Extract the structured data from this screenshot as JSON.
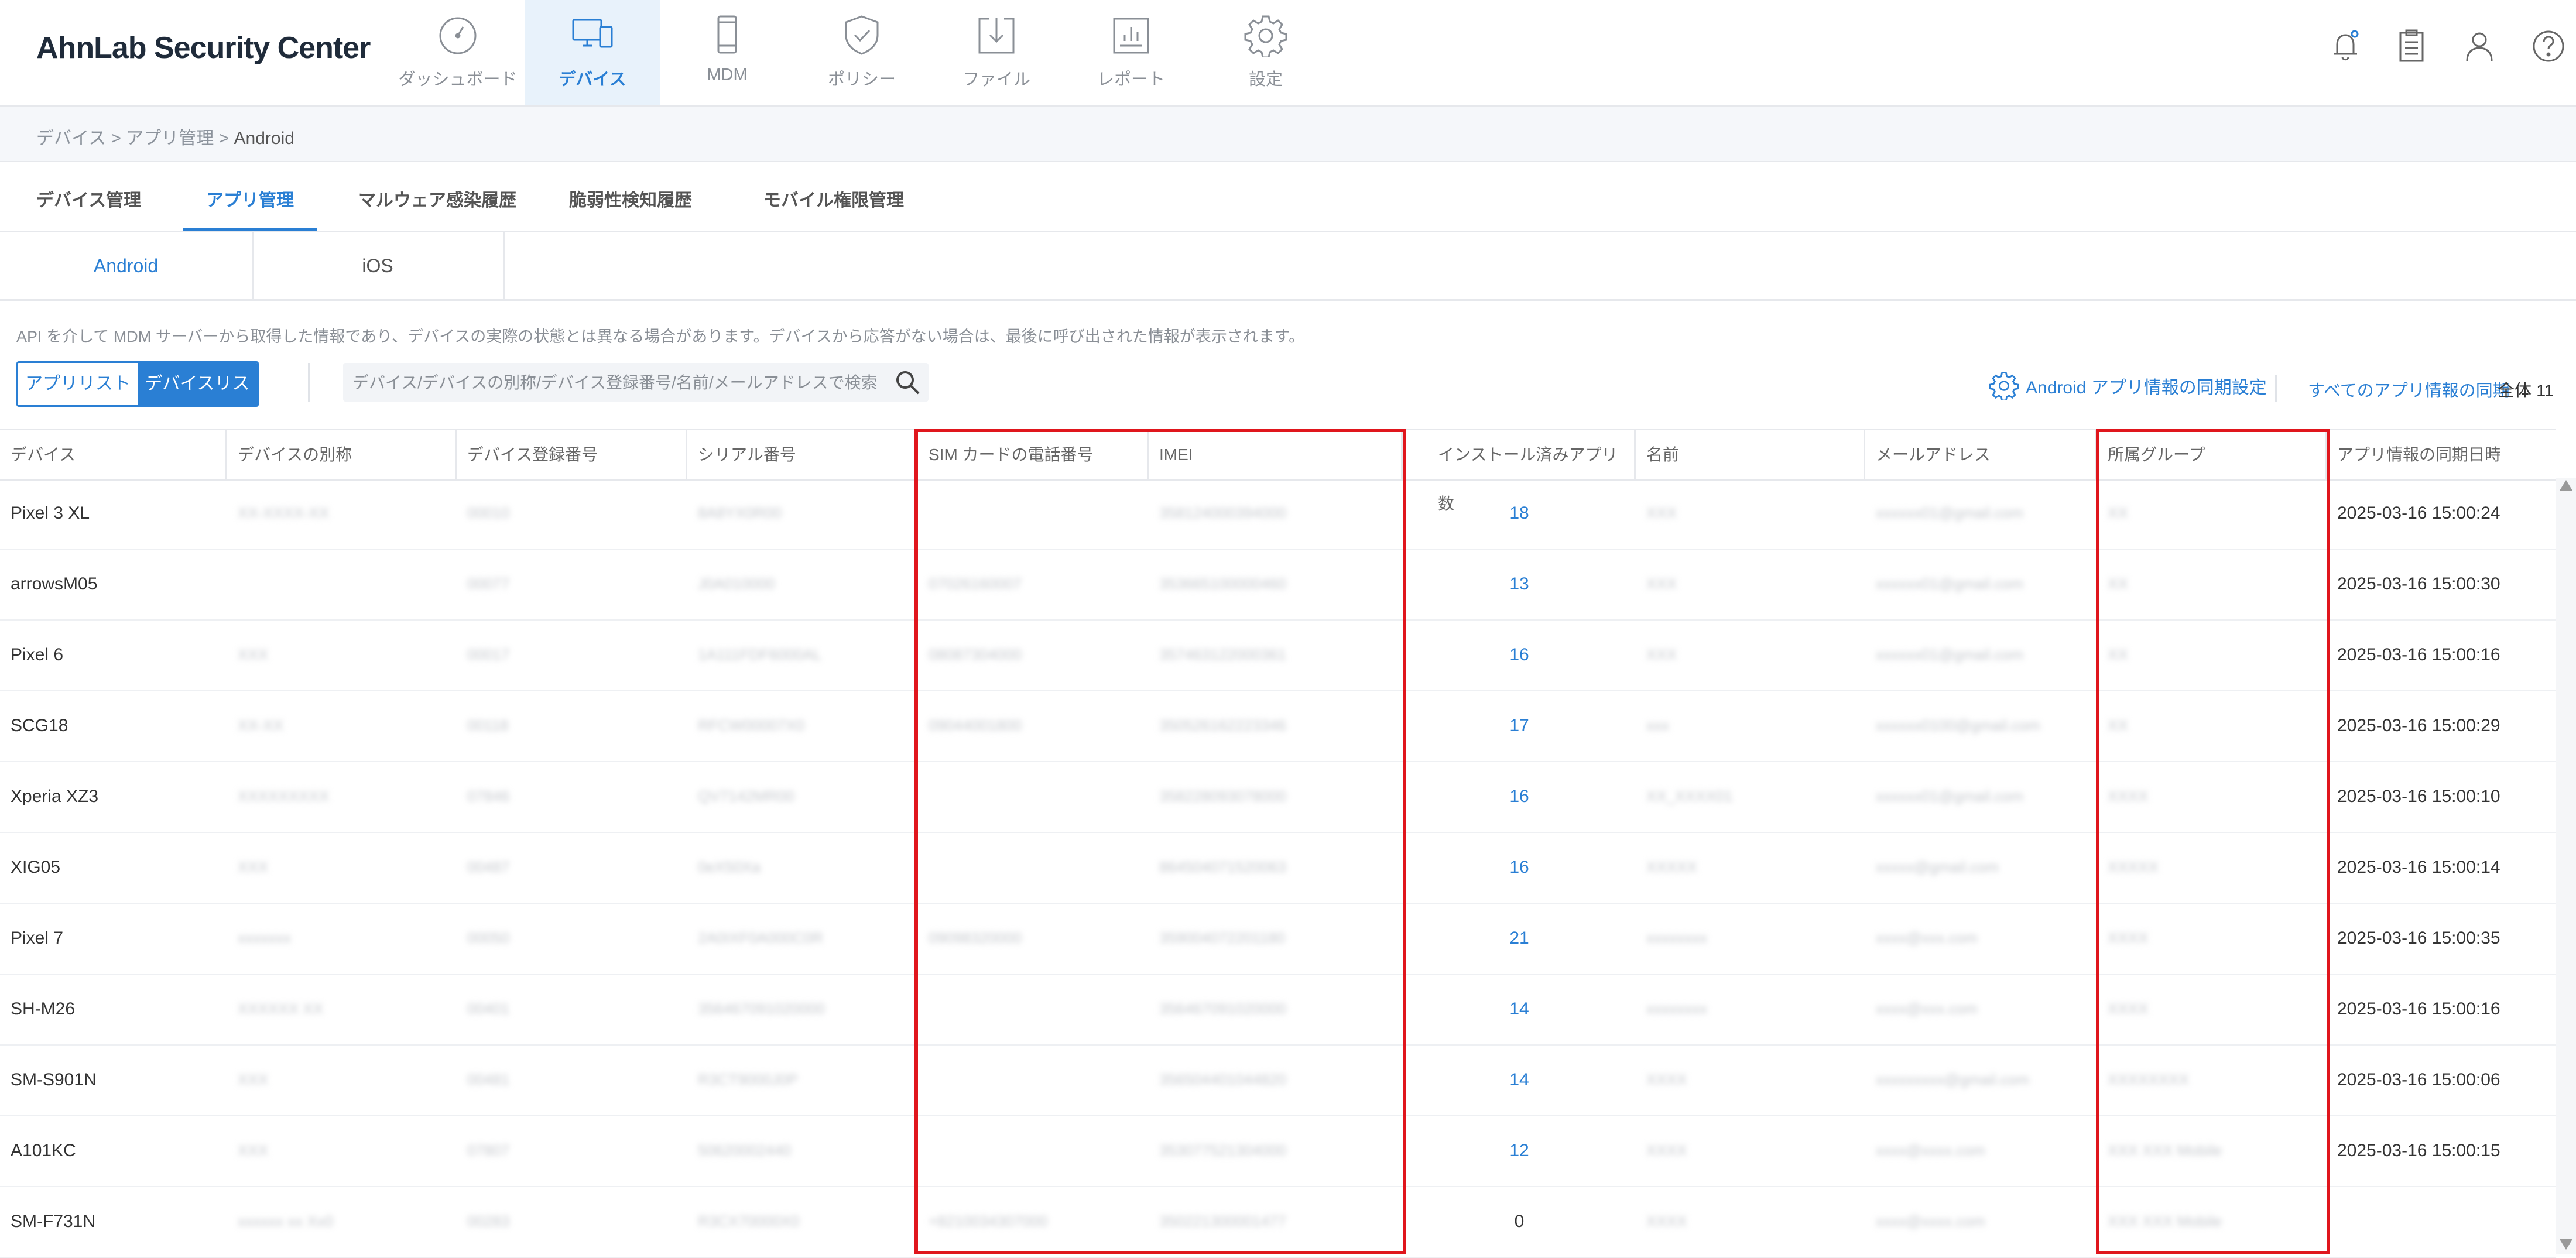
{
  "app": {
    "title": "AhnLab Security Center"
  },
  "nav": [
    {
      "label": "ダッシュボード",
      "icon": "dashboard-icon"
    },
    {
      "label": "デバイス",
      "icon": "device-icon",
      "active": true
    },
    {
      "label": "MDM",
      "icon": "mobile-icon"
    },
    {
      "label": "ポリシー",
      "icon": "shield-icon"
    },
    {
      "label": "ファイル",
      "icon": "file-download-icon"
    },
    {
      "label": "レポート",
      "icon": "report-icon"
    },
    {
      "label": "設定",
      "icon": "gear-icon"
    }
  ],
  "header_icons": [
    "bell-icon",
    "clipboard-icon",
    "user-icon",
    "help-icon"
  ],
  "breadcrumb": {
    "part1": "デバイス",
    "sep": " > ",
    "part2": "アプリ管理",
    "current": "Android"
  },
  "subtabs": [
    "デバイス管理",
    "アプリ管理",
    "マルウェア感染履歴",
    "脆弱性検知履歴",
    "モバイル権限管理"
  ],
  "ostabs": [
    "Android",
    "iOS"
  ],
  "notice": "API を介して MDM サーバーから取得した情報であり、デバイスの実際の状態とは異なる場合があります。デバイスから応答がない場合は、最後に呼び出された情報が表示されます。",
  "toolbar": {
    "app_list": "アプリリスト",
    "device_list": "デバイスリスト",
    "search_placeholder": "デバイス/デバイスの別称/デバイス登録番号/名前/メールアドレスで検索",
    "sync_settings": "Android アプリ情報の同期設定",
    "sync_all": "すべてのアプリ情報の同期",
    "total_label": "全体",
    "total_count": "11"
  },
  "table": {
    "columns": [
      "デバイス",
      "デバイスの別称",
      "デバイス登録番号",
      "シリアル番号",
      "SIM カードの電話番号",
      "IMEI",
      "インストール済みアプリ数",
      "名前",
      "メールアドレス",
      "所属グループ",
      "アプリ情報の同期日時"
    ],
    "rows": [
      {
        "device": "Pixel 3 XL",
        "alias": "XX-XXXX-XX",
        "regno": "00010",
        "serial": "8A8YX0R00",
        "sim": "",
        "imei": "358124000394000",
        "apps": "18",
        "name": "XXX",
        "email": "xxxxxx01@gmail.com",
        "group": "XX",
        "synced": "2025-03-16 15:00:24"
      },
      {
        "device": "arrowsM05",
        "alias": "",
        "regno": "00077",
        "serial": "J0A010000",
        "sim": "07026160007",
        "imei": "353665100000460",
        "apps": "13",
        "name": "XXX",
        "email": "xxxxxx01@gmail.com",
        "group": "XX",
        "synced": "2025-03-16 15:00:30"
      },
      {
        "device": "Pixel 6",
        "alias": "XXX",
        "regno": "00017",
        "serial": "1A111FDF6000AL",
        "sim": "08087304000",
        "imei": "357463122000361",
        "apps": "16",
        "name": "XXX",
        "email": "xxxxxx01@gmail.com",
        "group": "XX",
        "synced": "2025-03-16 15:00:16"
      },
      {
        "device": "SCG18",
        "alias": "XX-XX",
        "regno": "00118",
        "serial": "RFCW00007X0",
        "sim": "09044001800",
        "imei": "350526162223346",
        "apps": "17",
        "name": "xxx",
        "email": "xxxxxx0100@gmail.com",
        "group": "XX",
        "synced": "2025-03-16 15:00:29"
      },
      {
        "device": "Xperia XZ3",
        "alias": "XXXXXXXXX",
        "regno": "07846",
        "serial": "QV7142MR00",
        "sim": "",
        "imei": "358228093078000",
        "apps": "16",
        "name": "XX_XXXX01",
        "email": "xxxxxx01@gmail.com",
        "group": "XXXX",
        "synced": "2025-03-16 15:00:10"
      },
      {
        "device": "XIG05",
        "alias": "XXX",
        "regno": "00487",
        "serial": "0eX50Xa",
        "sim": "",
        "imei": "864504071520063",
        "apps": "16",
        "name": "XXXXX",
        "email": "xxxxx@gmail.com",
        "group": "XXXXX",
        "synced": "2025-03-16 15:00:14"
      },
      {
        "device": "Pixel 7",
        "alias": "xxxxxxx",
        "regno": "00050",
        "serial": "2A0IXF0A000C0R",
        "sim": "09098320000",
        "imei": "359004072201180",
        "apps": "21",
        "name": "xxxxxxxx",
        "email": "xxxx@xxx.com",
        "group": "XXXX",
        "synced": "2025-03-16 15:00:35"
      },
      {
        "device": "SH-M26",
        "alias": "XXXXXX XX",
        "regno": "00401",
        "serial": "356467091020000",
        "sim": "",
        "imei": "356467091020000",
        "apps": "14",
        "name": "xxxxxxxx",
        "email": "xxxx@xxx.com",
        "group": "XXXX",
        "synced": "2025-03-16 15:00:16"
      },
      {
        "device": "SM-S901N",
        "alias": "XXX",
        "regno": "00481",
        "serial": "R3CT9000J0P",
        "sim": "",
        "imei": "356504401044820",
        "apps": "14",
        "name": "XXXX",
        "email": "xxxxxxxxx@gmail.com",
        "group": "XXXXXXXX",
        "synced": "2025-03-16 15:00:06"
      },
      {
        "device": "A101KC",
        "alias": "XXX",
        "regno": "07807",
        "serial": "50620002440",
        "sim": "",
        "imei": "353077521304000",
        "apps": "12",
        "name": "XXXX",
        "email": "xxxx@xxxx.com",
        "group": "XXX XXX Mobile",
        "synced": "2025-03-16 15:00:15"
      },
      {
        "device": "SM-F731N",
        "alias": "xxxxxx xx Xx0",
        "regno": "00283",
        "serial": "R3CX70000X0",
        "sim": "+8210034307000",
        "imei": "350221300001477",
        "apps": "0",
        "name": "XXXX",
        "email": "xxxx@xxxx.com",
        "group": "XXX XXX Mobile",
        "synced": ""
      }
    ]
  },
  "colors": {
    "accent": "#2a7fd4",
    "highlight": "#e0161d",
    "active_nav_bg": "#e8f2fb"
  }
}
